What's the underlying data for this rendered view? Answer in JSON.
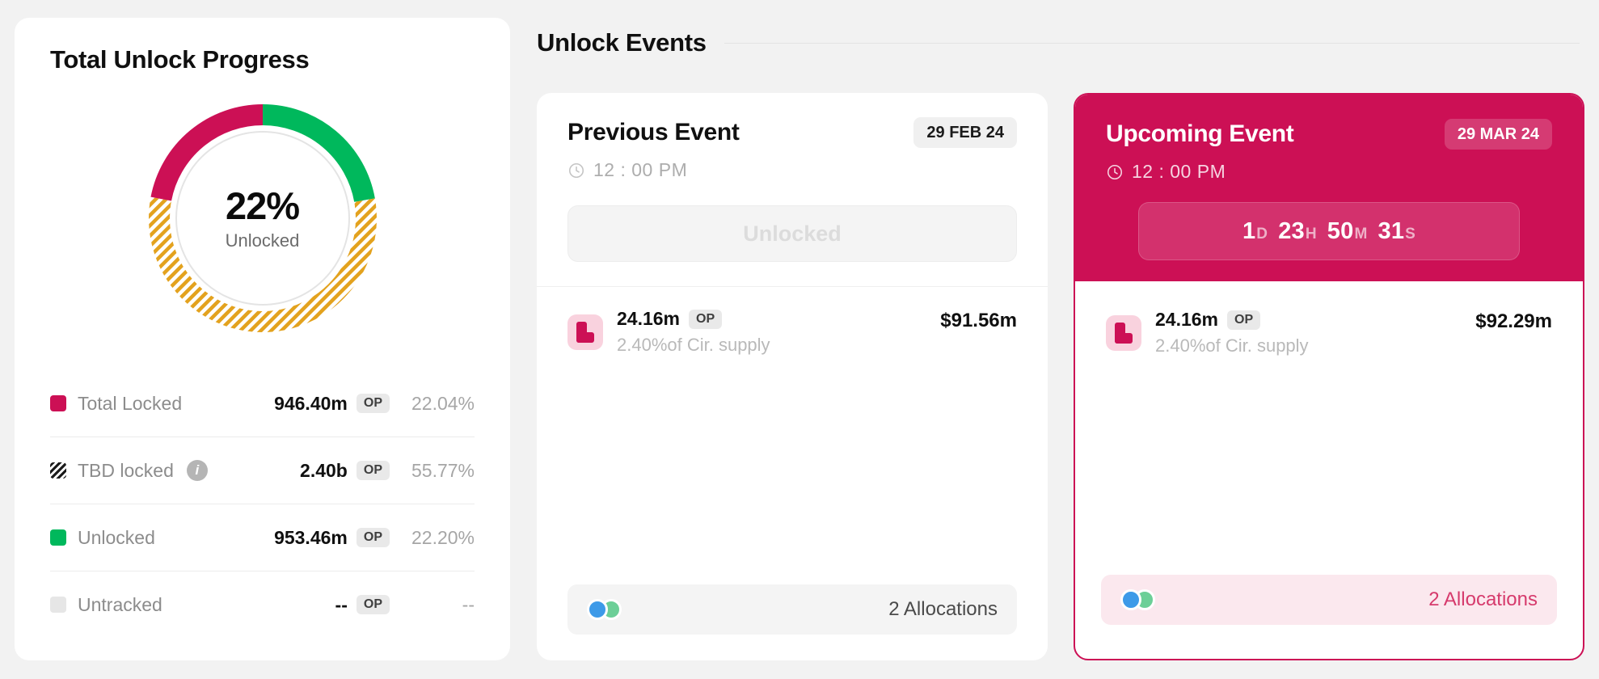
{
  "progress": {
    "title": "Total Unlock Progress",
    "donut": {
      "percent_label": "22%",
      "sub_label": "Unlocked"
    },
    "legend": [
      {
        "label": "Total Locked",
        "swatch": "solid-crimson",
        "value": "946.40m",
        "unit": "OP",
        "percent": "22.04%",
        "info": false
      },
      {
        "label": "TBD locked",
        "swatch": "striped",
        "value": "2.40b",
        "unit": "OP",
        "percent": "55.77%",
        "info": true,
        "info_glyph": "i"
      },
      {
        "label": "Unlocked",
        "swatch": "solid-green",
        "value": "953.46m",
        "unit": "OP",
        "percent": "22.20%",
        "info": false
      },
      {
        "label": "Untracked",
        "swatch": "solid-gray",
        "value": "--",
        "unit": "OP",
        "percent": "--",
        "info": false
      }
    ]
  },
  "events_section": {
    "heading": "Unlock Events"
  },
  "previous_event": {
    "title": "Previous Event",
    "date_badge": "29 FEB 24",
    "time": "12 : 00 PM",
    "clock_icon": "clock-icon",
    "status": "Unlocked",
    "token": {
      "icon": "op-token-icon",
      "amount": "24.16m",
      "unit": "OP",
      "sub": "2.40%of Cir. supply",
      "usd": "$91.56m"
    },
    "allocations": {
      "text": "2 Allocations",
      "avatar_colors": [
        "#3d9ae8",
        "#6ccf97"
      ]
    }
  },
  "upcoming_event": {
    "title": "Upcoming Event",
    "date_badge": "29 MAR 24",
    "time": "12 : 00 PM",
    "clock_icon": "clock-icon",
    "countdown": {
      "days": "1",
      "days_unit": "D",
      "hours": "23",
      "hours_unit": "H",
      "minutes": "50",
      "minutes_unit": "M",
      "seconds": "31",
      "seconds_unit": "S"
    },
    "token": {
      "icon": "op-token-icon",
      "amount": "24.16m",
      "unit": "OP",
      "sub": "2.40%of Cir. supply",
      "usd": "$92.29m"
    },
    "allocations": {
      "text": "2 Allocations",
      "avatar_colors": [
        "#3d9ae8",
        "#6ccf97"
      ]
    }
  },
  "chart_data": {
    "type": "pie",
    "title": "Total Unlock Progress",
    "center_label": "22%",
    "center_sublabel": "Unlocked",
    "categories": [
      "Unlocked",
      "TBD locked",
      "Total Locked"
    ],
    "values": [
      22.2,
      55.77,
      22.04
    ],
    "value_labels": [
      "953.46m OP",
      "2.40b OP",
      "946.40m OP"
    ],
    "colors": [
      "#00b85c",
      "#e3a21e",
      "#cc1055"
    ],
    "patterns": [
      "solid",
      "diagonal-stripes",
      "solid"
    ],
    "legend": [
      "Total Locked",
      "TBD locked",
      "Unlocked",
      "Untracked"
    ],
    "units": "OP",
    "start_angle_deg": 0,
    "direction": "clockwise"
  }
}
